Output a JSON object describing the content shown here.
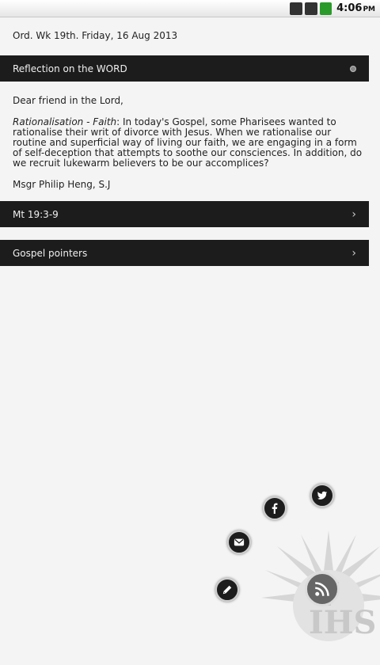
{
  "status_bar": {
    "time": "4:06",
    "ampm": "PM",
    "icons": [
      "sd-card-icon",
      "signal-icon",
      "battery-icon"
    ]
  },
  "header": {
    "date_line": "Ord. Wk 19th. Friday, 16 Aug 2013"
  },
  "sections": {
    "reflection_title": "Reflection on the WORD",
    "greeting": "Dear friend in the Lord,",
    "reflection_heading": "Rationalisation - Faith",
    "reflection_body": ": In today's Gospel, some Pharisees wanted to rationalise their writ of divorce with Jesus.  When we rationalise our routine and superficial way of living our faith, we are engaging in a form of self-deception that attempts to soothe our consciences. In addition, do we recruit lukewarm believers to be our accomplices?",
    "author": "Msgr Philip Heng, S.J",
    "scripture_title": "Mt 19:3-9",
    "pointers_title": "Gospel pointers"
  },
  "share_buttons": [
    "twitter-icon",
    "facebook-icon",
    "email-icon",
    "edit-icon",
    "feed-icon"
  ],
  "colors": {
    "bar_bg": "#1c1c1c",
    "page_bg": "#f4f4f4"
  }
}
